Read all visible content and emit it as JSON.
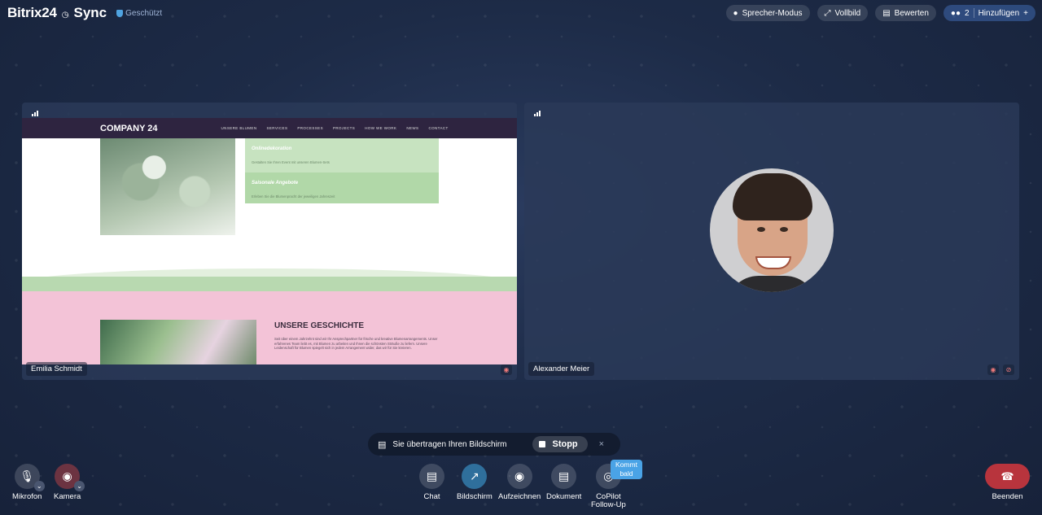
{
  "app": {
    "name": "Bitrix24",
    "clock_glyph": "◷",
    "product": "Sync",
    "protected_label": "Geschützt"
  },
  "topbar": {
    "speaker_mode": "Sprecher-Modus",
    "fullscreen": "Vollbild",
    "rate": "Bewerten",
    "participants_count": "2",
    "add": "Hinzufügen"
  },
  "tiles": [
    {
      "name": "Emilia Schmidt",
      "type": "screen-share"
    },
    {
      "name": "Alexander Meier",
      "type": "camera"
    }
  ],
  "shared_site": {
    "brand": "COMPANY 24",
    "nav": [
      "UNSERE BLUMEN",
      "SERVICES",
      "PROCESSES",
      "PROJECTS",
      "HOW WE WORK",
      "NEWS",
      "CONTACT"
    ],
    "card1_title": "Onlinedekoration",
    "card1_text": "Gestalten Sie Ihren Event mit unseren Blumen-Sets",
    "card2_title": "Saisonale Angebote",
    "card2_text": "Erleben Sie die Blumenpracht der jeweiligen Jahreszeit",
    "story_title": "UNSERE GESCHICHTE",
    "story_text": "Seit über einem Jahrzehnt sind wir Ihr Ansprechpartner für frische und kreative Blumenarrangements. Unser erfahrenes Team liebt es, mit Blumen zu arbeiten und Ihnen die schönsten Sträuße zu liefern. Unsere Leidenschaft für Blumen spiegelt sich in jedem Arrangement wider, das wir für Sie kreieren."
  },
  "share_bar": {
    "text": "Sie übertragen Ihren Bildschirm",
    "stop": "Stopp",
    "close": "×"
  },
  "controls": {
    "mic": "Mikrofon",
    "camera": "Kamera",
    "chat": "Chat",
    "screen": "Bildschirm",
    "record": "Aufzeichnen",
    "document": "Dokument",
    "copilot_line1": "CoPilot",
    "copilot_line2": "Follow-Up",
    "badge_line1": "Kommt",
    "badge_line2": "bald",
    "end": "Beenden"
  },
  "icons": {
    "mic": "mic-icon",
    "camera": "camera-off-icon",
    "chat": "chat-icon",
    "screen": "screen-share-icon",
    "record": "record-icon",
    "document": "document-icon",
    "copilot": "copilot-icon",
    "end": "hangup-icon"
  },
  "colors": {
    "end": "#b8343d",
    "screen_active": "#2f6f9c",
    "badge": "#4aa3e6",
    "accent": "#4fa3e0"
  }
}
